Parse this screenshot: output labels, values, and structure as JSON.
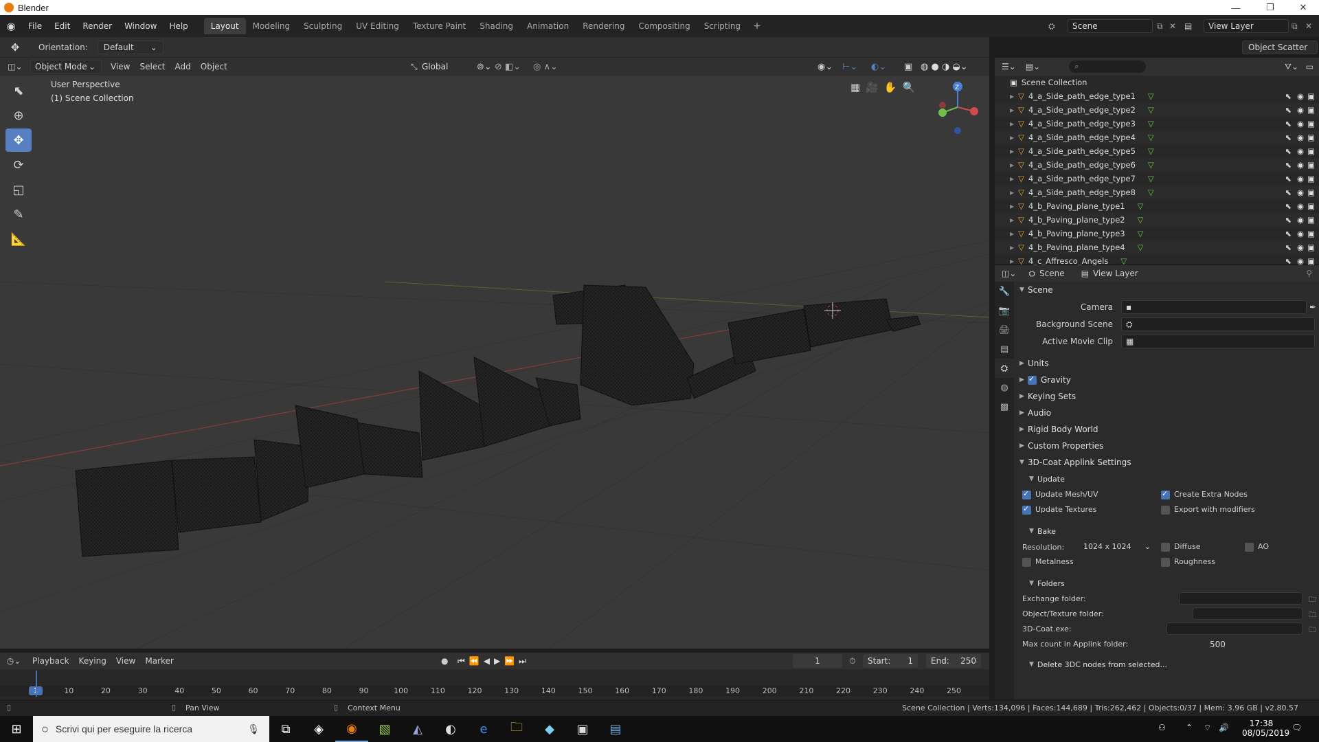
{
  "window": {
    "title": "Blender"
  },
  "menus": [
    "File",
    "Edit",
    "Render",
    "Window",
    "Help"
  ],
  "workspaces": [
    "Layout",
    "Modeling",
    "Sculpting",
    "UV Editing",
    "Texture Paint",
    "Shading",
    "Animation",
    "Rendering",
    "Compositing",
    "Scripting"
  ],
  "scene_selector": {
    "value": "Scene"
  },
  "viewlayer_selector": {
    "value": "View Layer"
  },
  "object_scatter": "Object Scatter",
  "tool_header": {
    "orientation_label": "Orientation:",
    "orientation_value": "Default"
  },
  "viewport_header": {
    "mode": "Object Mode",
    "menus": [
      "View",
      "Select",
      "Add",
      "Object"
    ],
    "transform": "Global"
  },
  "viewport": {
    "perspective": "User Perspective",
    "collection": "(1) Scene Collection",
    "gizmo_axis": "Z"
  },
  "outliner": {
    "root": "Scene Collection",
    "items": [
      "4_a_Side_path_edge_type1",
      "4_a_Side_path_edge_type2",
      "4_a_Side_path_edge_type3",
      "4_a_Side_path_edge_type4",
      "4_a_Side_path_edge_type5",
      "4_a_Side_path_edge_type6",
      "4_a_Side_path_edge_type7",
      "4_a_Side_path_edge_type8",
      "4_b_Paving_plane_type1",
      "4_b_Paving_plane_type2",
      "4_b_Paving_plane_type3",
      "4_b_Paving_plane_type4",
      "4_c_Affresco_Angels"
    ]
  },
  "properties": {
    "breadcrumb_scene": "Scene",
    "breadcrumb_viewlayer": "View Layer",
    "scene_panel": "Scene",
    "camera_label": "Camera",
    "background_scene_label": "Background Scene",
    "active_clip_label": "Active Movie Clip",
    "panels": [
      "Units",
      "Gravity",
      "Keying Sets",
      "Audio",
      "Rigid Body World",
      "Custom Properties",
      "3D-Coat Applink Settings"
    ],
    "update_panel": "Update",
    "update_mesh": "Update Mesh/UV",
    "update_textures": "Update Textures",
    "create_extra_nodes": "Create Extra Nodes",
    "export_modifiers": "Export with modifiers",
    "bake_panel": "Bake",
    "resolution_label": "Resolution:",
    "resolution_value": "1024 x 1024",
    "diffuse": "Diffuse",
    "ao": "AO",
    "metalness": "Metalness",
    "roughness": "Roughness",
    "folders_panel": "Folders",
    "exchange_folder": "Exchange folder:",
    "object_texture_folder": "Object/Texture folder:",
    "coat_exe": "3D-Coat.exe:",
    "max_count_label": "Max count in Applink folder:",
    "max_count_value": "500",
    "delete_panel": "Delete 3DC nodes from selected..."
  },
  "timeline": {
    "menus": [
      "Playback",
      "Keying",
      "View",
      "Marker"
    ],
    "current_frame": "1",
    "start_label": "Start:",
    "start_value": "1",
    "end_label": "End:",
    "end_value": "250",
    "ruler": [
      "1",
      "10",
      "20",
      "30",
      "40",
      "50",
      "60",
      "70",
      "80",
      "90",
      "100",
      "110",
      "120",
      "130",
      "140",
      "150",
      "160",
      "170",
      "180",
      "190",
      "200",
      "210",
      "220",
      "230",
      "240",
      "250"
    ]
  },
  "statusbar": {
    "pan_view": "Pan View",
    "context_menu": "Context Menu",
    "stats": "Scene Collection | Verts:134,096 | Faces:144,689 | Tris:262,462 | Objects:0/37 | Mem: 3.96 GB | v2.80.57"
  },
  "taskbar": {
    "search_placeholder": "Scrivi qui per eseguire la ricerca",
    "time": "17:38",
    "date": "08/05/2019"
  },
  "colors": {
    "accent": "#4772b3",
    "active_tool": "#5680c2",
    "mesh_icon": "#e8a040",
    "green_icon": "#6fbf4a"
  }
}
